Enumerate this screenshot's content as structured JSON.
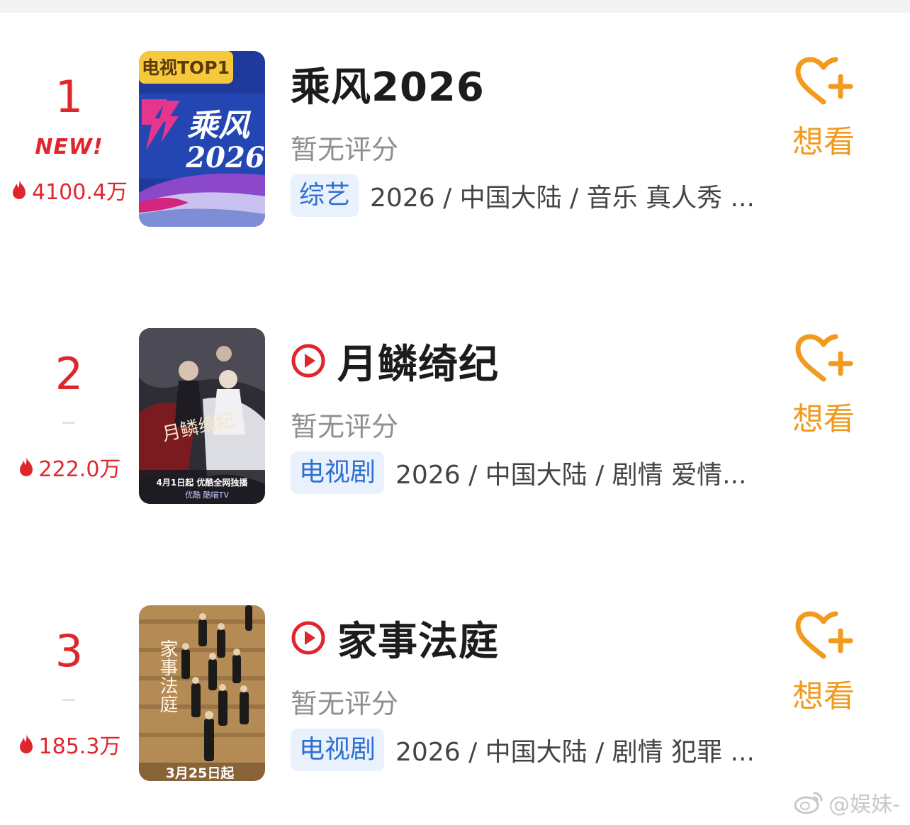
{
  "ranking": [
    {
      "rank": "1",
      "is_new": true,
      "new_label": "NEW!",
      "heat": "4100.4万",
      "title": "乘风2026",
      "has_play_icon": false,
      "rating": "暂无评分",
      "tag": "综艺",
      "meta": "2026 / 中国大陆 / 音乐 真人秀 ...",
      "poster": {
        "badge": "电视TOP1",
        "text_line1": "乘风",
        "text_line2": "2026"
      },
      "want_label": "想看"
    },
    {
      "rank": "2",
      "is_new": false,
      "heat": "222.0万",
      "title": "月鳞绮纪",
      "has_play_icon": true,
      "rating": "暂无评分",
      "tag": "电视剧",
      "meta": "2026 / 中国大陆 / 剧情 爱情...",
      "poster": {
        "caption": "4月1日起 优酷全网独播",
        "platforms": "优酷  酷喵TV",
        "title_art": "月鳞绮纪"
      },
      "want_label": "想看"
    },
    {
      "rank": "3",
      "is_new": false,
      "heat": "185.3万",
      "title": "家事法庭",
      "has_play_icon": true,
      "rating": "暂无评分",
      "tag": "电视剧",
      "meta": "2026 / 中国大陆 / 剧情 犯罪 ...",
      "poster": {
        "caption": "3月25日起",
        "title_art": "家事法庭"
      },
      "want_label": "想看"
    }
  ],
  "watermark": "@娱妹-",
  "colors": {
    "rank_red": "#e0262d",
    "want_orange": "#f29a1e",
    "tag_blue": "#2f6fd0",
    "tag_bg": "#e9f1fc"
  },
  "icons": {
    "heat": "flame-icon",
    "play": "play-circle-icon",
    "want": "heart-plus-icon",
    "watermark": "weibo-icon"
  }
}
